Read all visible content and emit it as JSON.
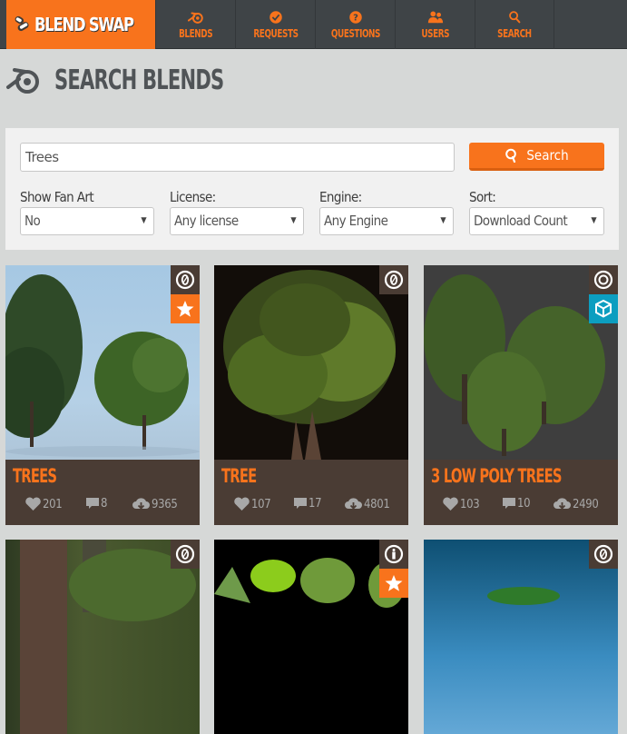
{
  "brand": {
    "name": "BLEND SWAP",
    "accent": "#f8731c"
  },
  "nav": [
    {
      "label": "BLENDS",
      "icon": "blender-icon"
    },
    {
      "label": "REQUESTS",
      "icon": "check-circle-icon"
    },
    {
      "label": "QUESTIONS",
      "icon": "question-circle-icon"
    },
    {
      "label": "USERS",
      "icon": "users-icon"
    },
    {
      "label": "SEARCH",
      "icon": "search-icon"
    }
  ],
  "page": {
    "title": "SEARCH BLENDS",
    "icon": "blender-icon"
  },
  "search": {
    "query": "Trees",
    "button_label": "Search",
    "filters": [
      {
        "label": "Show Fan Art",
        "value": "No"
      },
      {
        "label": "License:",
        "value": "Any license"
      },
      {
        "label": "Engine:",
        "value": "Any Engine"
      },
      {
        "label": "Sort:",
        "value": "Download Count"
      }
    ]
  },
  "results": [
    {
      "title": "TREES",
      "likes": "201",
      "comments": "8",
      "downloads": "9365",
      "license": "CC-0",
      "staff_pick": true,
      "extra_badge": "star"
    },
    {
      "title": "TREE",
      "likes": "107",
      "comments": "17",
      "downloads": "4801",
      "license": "CC-0",
      "staff_pick": false,
      "extra_badge": null
    },
    {
      "title": "3 LOW POLY TREES",
      "likes": "103",
      "comments": "10",
      "downloads": "2490",
      "license": "CC-BY",
      "staff_pick": false,
      "extra_badge": "cube"
    },
    {
      "title": "",
      "license": "CC-0",
      "extra_badge": null
    },
    {
      "title": "",
      "license": "CC-BY",
      "extra_badge": "star"
    },
    {
      "title": "",
      "license": "CC-0",
      "extra_badge": null
    }
  ]
}
